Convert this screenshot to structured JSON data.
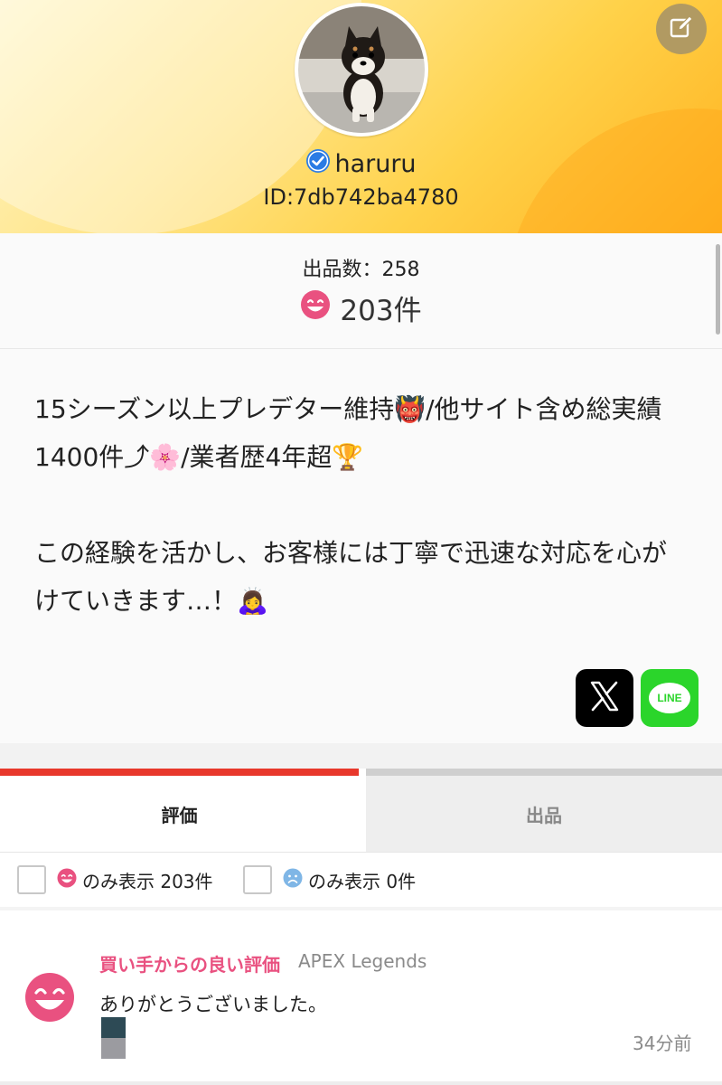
{
  "colors": {
    "accent_red": "#e8382c",
    "pink": "#e95180",
    "line_green": "#2bd52b",
    "verified_blue": "#2b7be4",
    "banner_yellow": "#ffd24a"
  },
  "header": {
    "edit_icon": "edit-icon",
    "username": "haruru",
    "verified_icon": "verified-check-icon",
    "user_id": "ID:7db742ba4780"
  },
  "stats": {
    "listing_count_label": "出品数：258",
    "good_rating_icon": "smiley-face-icon",
    "rating_count": "203件"
  },
  "bio": {
    "text": "15シーズン以上プレデター維持👹/他サイト含め総実績1400件⤴🌸/業者歴4年超🏆\n\nこの経験を活かし、お客様には丁寧で迅速な対応を心がけていきます…！🙇‍♀️"
  },
  "social": {
    "x_icon": "x-logo-icon",
    "line_label": "LINE"
  },
  "tabs": [
    {
      "label": "評価",
      "active": true
    },
    {
      "label": "出品",
      "active": false
    }
  ],
  "filters": {
    "good": {
      "label": "のみ表示 203件",
      "checked": false
    },
    "bad": {
      "label": "のみ表示 0件",
      "checked": false
    }
  },
  "reviews": [
    {
      "title": "買い手からの良い評価",
      "category": "APEX Legends",
      "text": "ありがとうございました。",
      "time": "34分前"
    }
  ]
}
